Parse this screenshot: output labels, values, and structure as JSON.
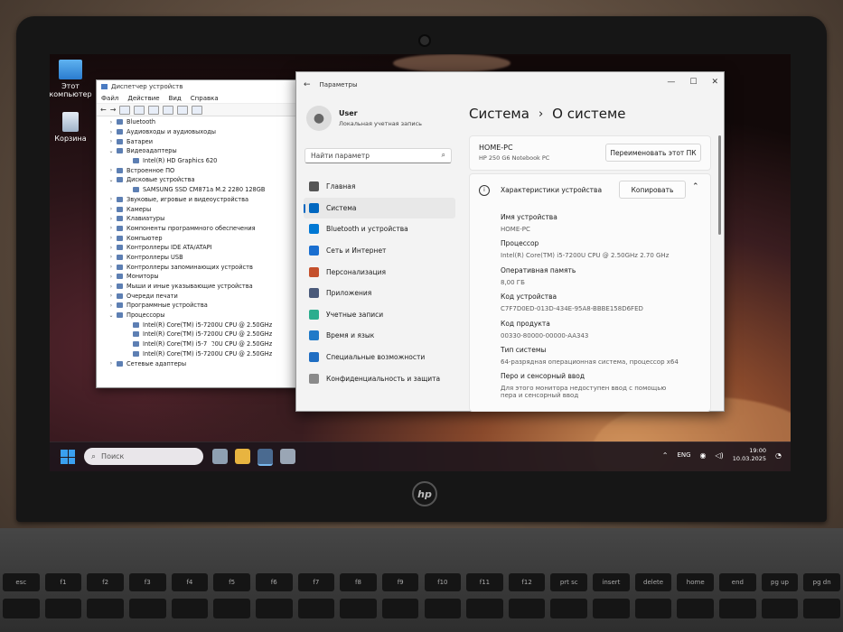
{
  "desktop": {
    "icons": [
      {
        "label": "Этот компьютер"
      },
      {
        "label": "Корзина"
      }
    ]
  },
  "device_manager": {
    "title": "Диспетчер устройств",
    "menu": [
      "Файл",
      "Действие",
      "Вид",
      "Справка"
    ],
    "tree": [
      {
        "label": "Bluetooth",
        "level": 1,
        "expanded": false
      },
      {
        "label": "Аудиовходы и аудиовыходы",
        "level": 1,
        "expanded": false
      },
      {
        "label": "Батареи",
        "level": 1,
        "expanded": false
      },
      {
        "label": "Видеоадаптеры",
        "level": 1,
        "expanded": true
      },
      {
        "label": "Intel(R) HD Graphics 620",
        "level": 2,
        "expanded": false
      },
      {
        "label": "Встроенное ПО",
        "level": 1,
        "expanded": false
      },
      {
        "label": "Дисковые устройства",
        "level": 1,
        "expanded": true
      },
      {
        "label": "SAMSUNG SSD CM871a M.2 2280 128GB",
        "level": 2,
        "expanded": false
      },
      {
        "label": "Звуковые, игровые и видеоустройства",
        "level": 1,
        "expanded": false
      },
      {
        "label": "Камеры",
        "level": 1,
        "expanded": false
      },
      {
        "label": "Клавиатуры",
        "level": 1,
        "expanded": false
      },
      {
        "label": "Компоненты программного обеспечения",
        "level": 1,
        "expanded": false
      },
      {
        "label": "Компьютер",
        "level": 1,
        "expanded": false
      },
      {
        "label": "Контроллеры IDE ATA/ATAPI",
        "level": 1,
        "expanded": false
      },
      {
        "label": "Контроллеры USB",
        "level": 1,
        "expanded": false
      },
      {
        "label": "Контроллеры запоминающих устройств",
        "level": 1,
        "expanded": false
      },
      {
        "label": "Мониторы",
        "level": 1,
        "expanded": false
      },
      {
        "label": "Мыши и иные указывающие устройства",
        "level": 1,
        "expanded": false
      },
      {
        "label": "Очереди печати",
        "level": 1,
        "expanded": false
      },
      {
        "label": "Программные устройства",
        "level": 1,
        "expanded": false
      },
      {
        "label": "Процессоры",
        "level": 1,
        "expanded": true
      },
      {
        "label": "Intel(R) Core(TM) i5-7200U CPU @ 2.50GHz",
        "level": 2,
        "expanded": false
      },
      {
        "label": "Intel(R) Core(TM) i5-7200U CPU @ 2.50GHz",
        "level": 2,
        "expanded": false
      },
      {
        "label": "Intel(R) Core(TM) i5-7200U CPU @ 2.50GHz",
        "level": 2,
        "expanded": false
      },
      {
        "label": "Intel(R) Core(TM) i5-7200U CPU @ 2.50GHz",
        "level": 2,
        "expanded": false
      },
      {
        "label": "Сетевые адаптеры",
        "level": 1,
        "expanded": false
      }
    ]
  },
  "settings": {
    "window_title": "Параметры",
    "user_name": "User",
    "user_sub": "Локальная учетная запись",
    "search_placeholder": "Найти параметр",
    "nav": [
      {
        "label": "Главная",
        "icon": "home-icon",
        "color": "#555555"
      },
      {
        "label": "Система",
        "icon": "monitor-icon",
        "color": "#0067c0",
        "active": true
      },
      {
        "label": "Bluetooth и устройства",
        "icon": "bluetooth-icon",
        "color": "#0078d4"
      },
      {
        "label": "Сеть и Интернет",
        "icon": "wifi-icon",
        "color": "#1a6fd0"
      },
      {
        "label": "Персонализация",
        "icon": "brush-icon",
        "color": "#c4502c"
      },
      {
        "label": "Приложения",
        "icon": "apps-icon",
        "color": "#4a5a7a"
      },
      {
        "label": "Учетные записи",
        "icon": "person-icon",
        "color": "#2bad8e"
      },
      {
        "label": "Время и язык",
        "icon": "globe-clock-icon",
        "color": "#1f7ac8"
      },
      {
        "label": "Специальные возможности",
        "icon": "accessibility-icon",
        "color": "#1f6dc2"
      },
      {
        "label": "Конфиденциальность и защита",
        "icon": "shield-icon",
        "color": "#8a8a8a"
      }
    ],
    "breadcrumb_parent": "Система",
    "breadcrumb_sep": "›",
    "breadcrumb_current": "О системе",
    "pc_name": "HOME-PC",
    "pc_model": "HP 250 G6 Notebook PC",
    "rename_button": "Переименовать этот ПК",
    "specs_title": "Характеристики устройства",
    "copy_button": "Копировать",
    "specs": [
      {
        "label": "Имя устройства",
        "value": "HOME-PC"
      },
      {
        "label": "Процессор",
        "value": "Intel(R) Core(TM) i5-7200U CPU @ 2.50GHz   2.70 GHz"
      },
      {
        "label": "Оперативная память",
        "value": "8,00 ГБ"
      },
      {
        "label": "Код устройства",
        "value": "C7F7D0ED-013D-434E-95A8-BBBE158D6FED"
      },
      {
        "label": "Код продукта",
        "value": "00330-80000-00000-AA343"
      },
      {
        "label": "Тип системы",
        "value": "64-разрядная операционная система, процессор x64"
      },
      {
        "label": "Перо и сенсорный ввод",
        "value": "Для этого монитора недоступен ввод с помощью пера и сенсорный ввод"
      }
    ]
  },
  "taskbar": {
    "search_placeholder": "Поиск",
    "language": "ENG",
    "time": "19:00",
    "date": "10.03.2025"
  },
  "brand_logo": "hp",
  "keyboard_row1": [
    "esc",
    "f1",
    "f2",
    "f3",
    "f4",
    "f5",
    "f6",
    "f7",
    "f8",
    "f9",
    "f10",
    "f11",
    "f12",
    "prt sc",
    "insert",
    "delete",
    "home",
    "end",
    "pg up",
    "pg dn"
  ]
}
